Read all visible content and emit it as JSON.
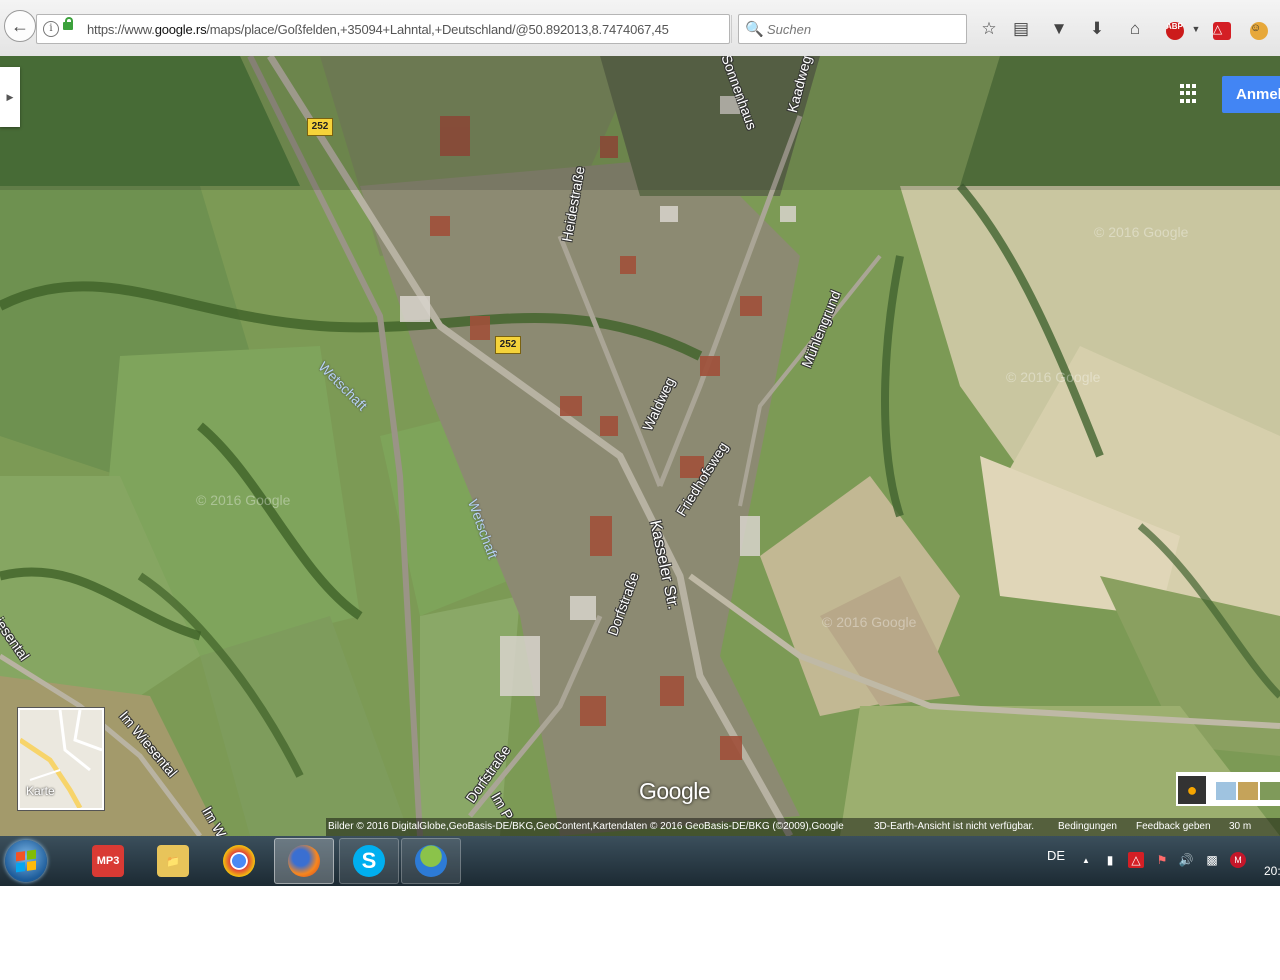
{
  "browser": {
    "url_prefix": "https://www.",
    "url_domain": "google.rs",
    "url_rest": "/maps/place/Goßfelden,+35094+Lahntal,+Deutschland/@50.892013,8.7474067,45",
    "search_placeholder": "Suchen"
  },
  "map": {
    "signin_label": "Anmel",
    "route_numbers": [
      "252",
      "252"
    ],
    "streets": [
      "Sonnenhaus",
      "Kaadweg",
      "Heidestraße",
      "Mühlengrund",
      "Waldweg",
      "Friedhofsweg",
      "Kasseler Str.",
      "Dorfstraße",
      "Im Wiesental",
      "Im W",
      "Dorfstraße",
      "Im P",
      "iesental"
    ],
    "waters": [
      "Wetschaft",
      "Wetschaft"
    ],
    "watermarks": [
      "© 2016 Google",
      "© 2016 Google",
      "© 2016 Google",
      "© 2016 Google"
    ],
    "karte_label": "Karte",
    "google_logo": "Google",
    "footer": {
      "imagery": "Bilder © 2016 DigitalGlobe,GeoBasis-DE/BKG,GeoContent,Kartendaten © 2016 GeoBasis-DE/BKG (©2009),Google",
      "earth": "3D-Earth-Ansicht ist nicht verfügbar.",
      "terms": "Bedingungen",
      "feedback": "Feedback geben",
      "scale": "30 m"
    }
  },
  "taskbar": {
    "language": "DE",
    "clock": "20:",
    "apps": [
      "MP3",
      "Explorer",
      "Chrome",
      "Firefox",
      "Skype",
      "Messenger"
    ]
  }
}
